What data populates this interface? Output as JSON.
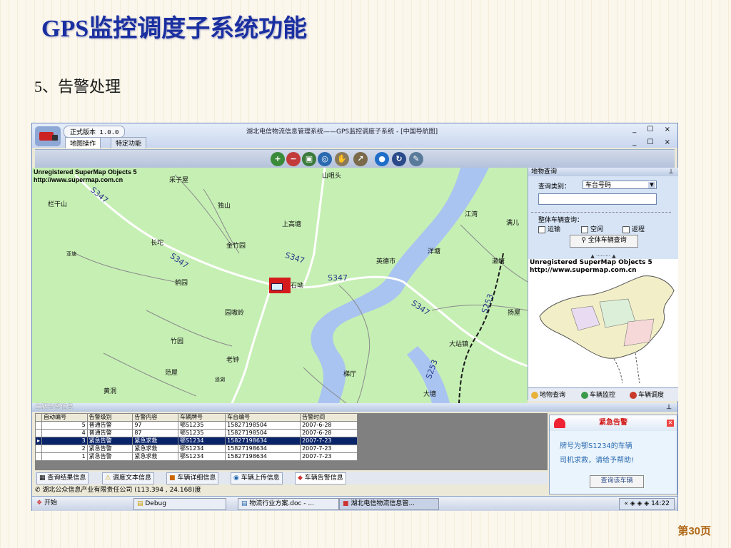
{
  "slide": {
    "title": "GPS监控调度子系统功能",
    "subtitle": "5、告警处理",
    "page": "第30页"
  },
  "app": {
    "version": "正式版本 1.0.0",
    "window_title": "湖北电信物流信息管理系统——GPS监控调度子系统 - [中国导航图]",
    "window_controls": "_ ☐ ×",
    "child_controls": "_ ☐ ×",
    "tabs": [
      "地图操作",
      "特定功能"
    ],
    "toolbar_icons": [
      "zoom-in-icon",
      "zoom-out-icon",
      "zoom-rect-icon",
      "globe-icon",
      "pan-icon",
      "measure-icon",
      "earth-icon",
      "refresh-icon",
      "edit-icon"
    ]
  },
  "map": {
    "watermark": [
      "Unregistered SuperMap Objects 5",
      "http://www.supermap.com.cn"
    ],
    "places": [
      "采子屋",
      "山咀头",
      "栏干山",
      "独山",
      "江湾",
      "上高塘",
      "长坨",
      "金竹园",
      "洋塘",
      "鹤园",
      "石坳",
      "英德市",
      "濑塘",
      "园嗷岭",
      "竹园",
      "扬屋",
      "老钟",
      "大站镇",
      "范屋",
      "黄洞",
      "梯厅",
      "大塘",
      "亚塘",
      "遥湖",
      "满儿"
    ],
    "roads": [
      "S347",
      "S347",
      "S347",
      "S347",
      "S347",
      "S253",
      "S253"
    ],
    "colors": {
      "land": "#c6efb4",
      "water": "#a9c4f0",
      "road": "#ffffff"
    }
  },
  "right_panel": {
    "title": "地物查询",
    "pin": "⊥",
    "query_type_label": "查询类别：",
    "query_type_value": "车台号码",
    "overall_label": "整体车辆查询：",
    "options": [
      "运输",
      "空闲",
      "返程"
    ],
    "button": "全体车辆查询",
    "mini_watermark": [
      "Unregistered SuperMap Objects 5",
      "http://www.supermap.com.cn"
    ],
    "tabs": [
      "地物查询",
      "车辆监控",
      "车辆调度"
    ]
  },
  "alarm": {
    "header": "车辆告警信息",
    "pin": "⊥",
    "columns": [
      "自动编号",
      "告警级别",
      "告警内容",
      "车辆牌号",
      "车台编号",
      "告警时间"
    ],
    "rows": [
      [
        "5",
        "普通告警",
        "97",
        "鄂S1235",
        "15827198504",
        "2007-6-28"
      ],
      [
        "4",
        "普通告警",
        "87",
        "鄂S1235",
        "15827198504",
        "2007-6-28"
      ],
      [
        "3",
        "紧急告警",
        "紧急求救",
        "鄂S1234",
        "15827198634",
        "2007-7-23"
      ],
      [
        "2",
        "紧急告警",
        "紧急求救",
        "鄂S1234",
        "15827198634",
        "2007-7-23"
      ],
      [
        "1",
        "紧急告警",
        "紧急求救",
        "鄂S1234",
        "15827198634",
        "2007-7-23"
      ]
    ],
    "selected_row": 2,
    "bottom_tabs": [
      "查询结果信息",
      "调度文本信息",
      "车辆详细信息",
      "车辆上传信息",
      "车辆告警信息"
    ],
    "status": "湖北公众信息产业有限责任公司 (113.394 , 24.168)度"
  },
  "emergency": {
    "title": "紧急告警",
    "line1": "牌号为鄂S1234的车辆",
    "line2": "司机求救，请给予帮助!",
    "button": "查询该车辆"
  },
  "taskbar": {
    "start": "开始",
    "items": [
      "Debug",
      "物流行业方案.doc - ...",
      "湖北电信物流信息管..."
    ],
    "clock": "14:22"
  }
}
